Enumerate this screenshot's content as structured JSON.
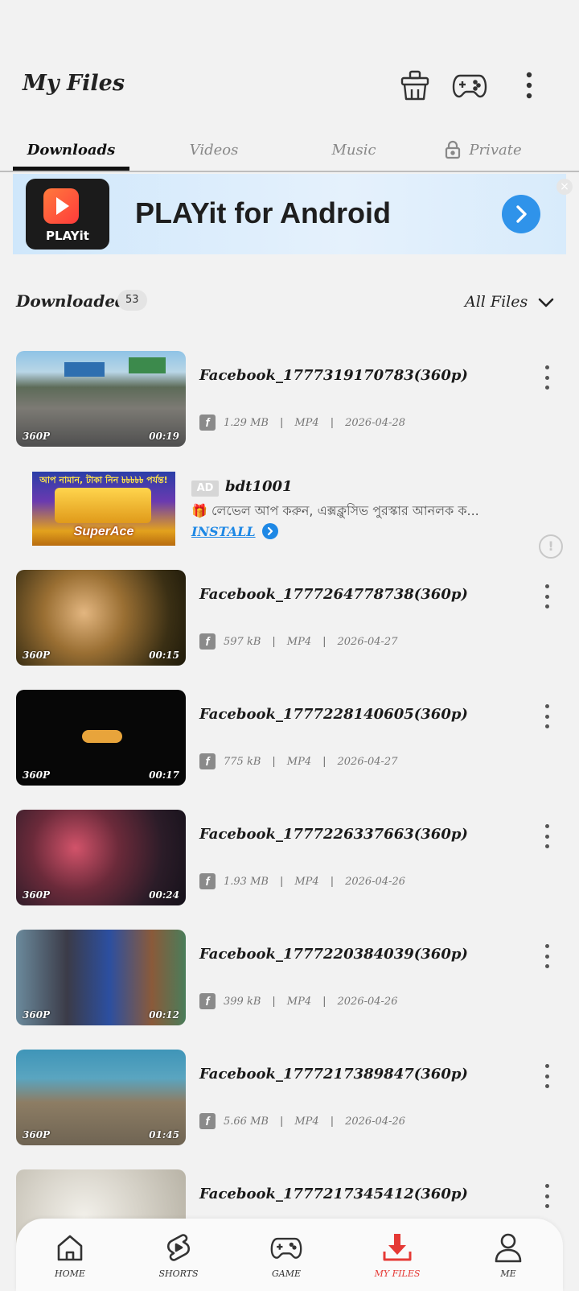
{
  "header": {
    "title": "My Files",
    "icons": [
      "cleaner-icon",
      "gamepad-icon",
      "more-vertical-icon"
    ]
  },
  "tabs": [
    {
      "label": "Downloads",
      "active": true
    },
    {
      "label": "Videos",
      "active": false
    },
    {
      "label": "Music",
      "active": false
    },
    {
      "label": "Private",
      "active": false,
      "icon": "lock-icon"
    }
  ],
  "banner_ad": {
    "logo_text": "PLAYit",
    "text": "PLAYit for Android"
  },
  "section": {
    "title": "Downloaded",
    "count": "53",
    "filter": "All Files"
  },
  "inline_ad": {
    "badge": "AD",
    "title": "bdt1001",
    "description": "🎁 লেভেল আপ করুন, এক্সক্লুসিভ পুরস্কার আনলক ক...",
    "cta": "INSTALL",
    "image_top_text": "আপ নামান, টাকা নিন ৳৳৳৳৳ পর্যন্ত!",
    "image_text": "SuperAce"
  },
  "files": [
    {
      "name": "Facebook_1777319170783(360p)",
      "quality": "360P",
      "duration": "00:19",
      "size": "1.29 MB",
      "format": "MP4",
      "date": "2026-04-28"
    },
    {
      "name": "Facebook_1777264778738(360p)",
      "quality": "360P",
      "duration": "00:15",
      "size": "597 kB",
      "format": "MP4",
      "date": "2026-04-27"
    },
    {
      "name": "Facebook_1777228140605(360p)",
      "quality": "360P",
      "duration": "00:17",
      "size": "775 kB",
      "format": "MP4",
      "date": "2026-04-27"
    },
    {
      "name": "Facebook_1777226337663(360p)",
      "quality": "360P",
      "duration": "00:24",
      "size": "1.93 MB",
      "format": "MP4",
      "date": "2026-04-26"
    },
    {
      "name": "Facebook_1777220384039(360p)",
      "quality": "360P",
      "duration": "00:12",
      "size": "399 kB",
      "format": "MP4",
      "date": "2026-04-26"
    },
    {
      "name": "Facebook_1777217389847(360p)",
      "quality": "360P",
      "duration": "01:45",
      "size": "5.66 MB",
      "format": "MP4",
      "date": "2026-04-26"
    },
    {
      "name": "Facebook_1777217345412(360p)",
      "quality": "",
      "duration": "",
      "size": "",
      "format": "",
      "date": ""
    }
  ],
  "bottom_nav": [
    {
      "label": "HOME",
      "icon": "home-icon",
      "active": false
    },
    {
      "label": "SHORTS",
      "icon": "shorts-icon",
      "active": false
    },
    {
      "label": "GAME",
      "icon": "gamepad-icon",
      "active": false
    },
    {
      "label": "MY FILES",
      "icon": "download-icon",
      "active": true
    },
    {
      "label": "ME",
      "icon": "user-icon",
      "active": false
    }
  ],
  "colors": {
    "background": "#f2f2f2",
    "accent_red": "#e53935",
    "link_blue": "#1e88e5",
    "banner_button": "#2f93ea"
  }
}
